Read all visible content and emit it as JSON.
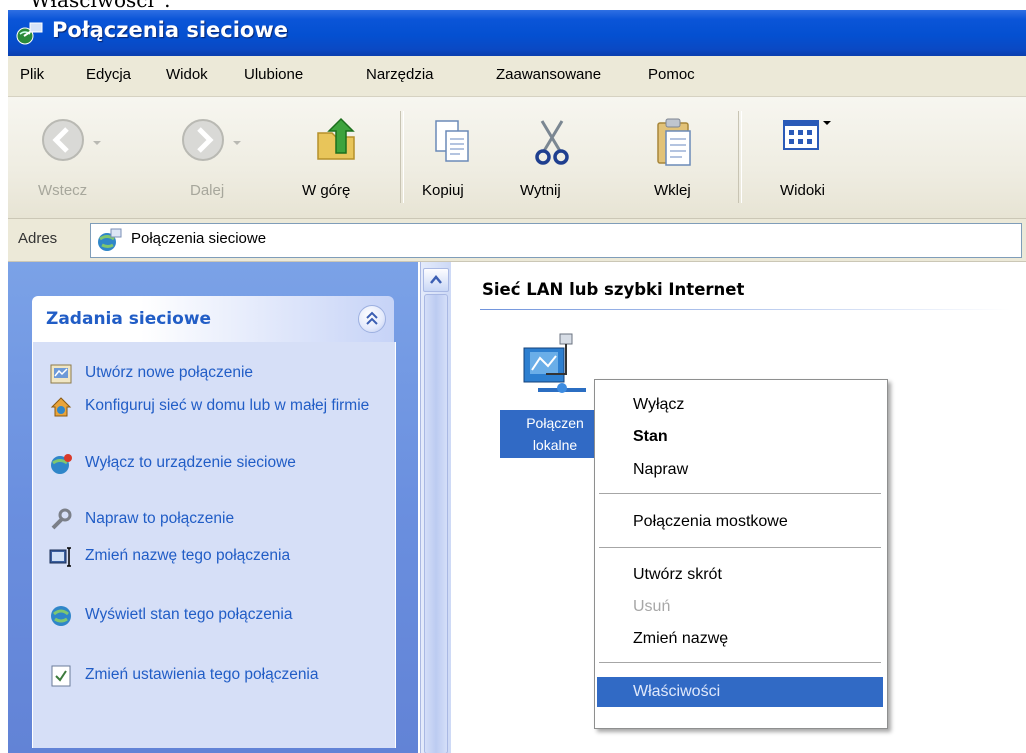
{
  "caption": "Właściwości”.",
  "window": {
    "title": "Połączenia sieciowe"
  },
  "menu": {
    "items": [
      "Plik",
      "Edycja",
      "Widok",
      "Ulubione",
      "Narzędzia",
      "Zaawansowane",
      "Pomoc"
    ]
  },
  "toolbar": {
    "back": "Wstecz",
    "forward": "Dalej",
    "up": "W górę",
    "copy": "Kopiuj",
    "cut": "Wytnij",
    "paste": "Wklej",
    "views": "Widoki"
  },
  "address": {
    "label": "Adres",
    "value": "Połączenia sieciowe"
  },
  "tasks": {
    "header": "Zadania sieciowe",
    "items": [
      {
        "label": "Utwórz nowe połączenie",
        "icon": "new-connection-icon"
      },
      {
        "label": "Konfiguruj sieć w domu lub w małej firmie",
        "icon": "home-network-icon"
      },
      {
        "label": "Wyłącz to urządzenie sieciowe",
        "icon": "disable-device-icon"
      },
      {
        "label": "Napraw to połączenie",
        "icon": "repair-wrench-icon"
      },
      {
        "label": "Zmień nazwę tego połączenia",
        "icon": "rename-icon"
      },
      {
        "label": "Wyświetl stan tego połączenia",
        "icon": "status-globe-icon"
      },
      {
        "label": "Zmień ustawienia tego połączenia",
        "icon": "settings-document-icon"
      }
    ]
  },
  "content": {
    "group_title": "Sieć LAN lub szybki Internet",
    "connection_label_line1": "Połączen",
    "connection_label_line2": "lokalne"
  },
  "context_menu": {
    "items": [
      "Wyłącz",
      "Stan",
      "Napraw",
      "Połączenia mostkowe",
      "Utwórz skrót",
      "Usuń",
      "Zmień nazwę",
      "Właściwości"
    ]
  },
  "colors": {
    "titlebar": "#0450d1",
    "selection": "#316ac5",
    "task_link": "#215dc6"
  }
}
